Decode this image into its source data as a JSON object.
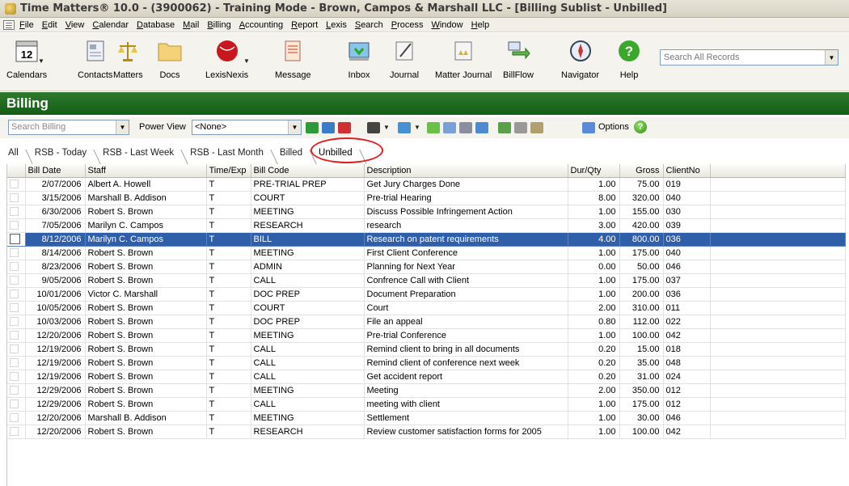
{
  "window": {
    "title": "Time Matters® 10.0 - (3900062) - Training Mode - Brown, Campos & Marshall LLC - [Billing Sublist - Unbilled]"
  },
  "menu": [
    "File",
    "Edit",
    "View",
    "Calendar",
    "Database",
    "Mail",
    "Billing",
    "Accounting",
    "Report",
    "Lexis",
    "Search",
    "Process",
    "Window",
    "Help"
  ],
  "toolbar": {
    "calendar_day": "12",
    "buttons": [
      {
        "label": "Calendars",
        "icon": "calendar-icon"
      },
      {
        "label": "Contacts",
        "icon": "contacts-icon"
      },
      {
        "label": "Matters",
        "icon": "scales-icon"
      },
      {
        "label": "Docs",
        "icon": "folder-icon"
      },
      {
        "label": "LexisNexis",
        "icon": "lexisnexis-icon"
      },
      {
        "label": "Message",
        "icon": "message-icon"
      },
      {
        "label": "Inbox",
        "icon": "inbox-icon"
      },
      {
        "label": "Journal",
        "icon": "journal-icon"
      },
      {
        "label": "Matter Journal",
        "icon": "matter-journal-icon"
      },
      {
        "label": "BillFlow",
        "icon": "billflow-icon"
      },
      {
        "label": "Navigator",
        "icon": "compass-icon"
      },
      {
        "label": "Help",
        "icon": "help-icon"
      }
    ],
    "search_placeholder": "Search All Records"
  },
  "billing": {
    "header": "Billing",
    "search_placeholder": "Search Billing",
    "power_view_label": "Power View",
    "power_view_value": "<None>",
    "options_label": "Options",
    "help_glyph": "?"
  },
  "tabs": [
    "All",
    "RSB - Today",
    "RSB - Last Week",
    "RSB - Last Month",
    "Billed",
    "Unbilled"
  ],
  "active_tab": "Unbilled",
  "table": {
    "columns": [
      "",
      "Bill Date",
      "Staff",
      "Time/Exp",
      "Bill Code",
      "Description",
      "Dur/Qty",
      "Gross",
      "ClientNo"
    ],
    "selected_row": 4,
    "rows": [
      [
        "2/07/2006",
        "Albert A. Howell",
        "T",
        "PRE-TRIAL PREP",
        "Get Jury Charges Done",
        "1.00",
        "75.00",
        "019"
      ],
      [
        "3/15/2006",
        "Marshall B. Addison",
        "T",
        "COURT",
        "Pre-trial Hearing",
        "8.00",
        "320.00",
        "040"
      ],
      [
        "6/30/2006",
        "Robert S. Brown",
        "T",
        "MEETING",
        "Discuss Possible Infringement Action",
        "1.00",
        "155.00",
        "030"
      ],
      [
        "7/05/2006",
        "Marilyn C. Campos",
        "T",
        "RESEARCH",
        "research",
        "3.00",
        "420.00",
        "039"
      ],
      [
        "8/12/2006",
        "Marilyn C. Campos",
        "T",
        "BILL",
        "Research on patent requirements",
        "4.00",
        "800.00",
        "036"
      ],
      [
        "8/14/2006",
        "Robert S. Brown",
        "T",
        "MEETING",
        "First Client Conference",
        "1.00",
        "175.00",
        "040"
      ],
      [
        "8/23/2006",
        "Robert S. Brown",
        "T",
        "ADMIN",
        "Planning for Next Year",
        "0.00",
        "50.00",
        "046"
      ],
      [
        "9/05/2006",
        "Robert S. Brown",
        "T",
        "CALL",
        "Confrence Call with Client",
        "1.00",
        "175.00",
        "037"
      ],
      [
        "10/01/2006",
        "Victor C. Marshall",
        "T",
        "DOC PREP",
        "Document Preparation",
        "1.00",
        "200.00",
        "036"
      ],
      [
        "10/05/2006",
        "Robert S. Brown",
        "T",
        "COURT",
        "Court",
        "2.00",
        "310.00",
        "011"
      ],
      [
        "10/03/2006",
        "Robert S. Brown",
        "T",
        "DOC PREP",
        "File an appeal",
        "0.80",
        "112.00",
        "022"
      ],
      [
        "12/20/2006",
        "Robert S. Brown",
        "T",
        "MEETING",
        "Pre-trial Conference",
        "1.00",
        "100.00",
        "042"
      ],
      [
        "12/19/2006",
        "Robert S. Brown",
        "T",
        "CALL",
        "Remind client to bring in all documents",
        "0.20",
        "15.00",
        "018"
      ],
      [
        "12/19/2006",
        "Robert S. Brown",
        "T",
        "CALL",
        "Remind client of conference next week",
        "0.20",
        "35.00",
        "048"
      ],
      [
        "12/19/2006",
        "Robert S. Brown",
        "T",
        "CALL",
        "Get accident report",
        "0.20",
        "31.00",
        "024"
      ],
      [
        "12/29/2006",
        "Robert S. Brown",
        "T",
        "MEETING",
        "Meeting",
        "2.00",
        "350.00",
        "012"
      ],
      [
        "12/29/2006",
        "Robert S. Brown",
        "T",
        "CALL",
        "meeting with client",
        "1.00",
        "175.00",
        "012"
      ],
      [
        "12/20/2006",
        "Marshall B. Addison",
        "T",
        "MEETING",
        "Settlement",
        "1.00",
        "30.00",
        "046"
      ],
      [
        "12/20/2006",
        "Robert S. Brown",
        "T",
        "RESEARCH",
        "Review customer satisfaction forms for 2005",
        "1.00",
        "100.00",
        "042"
      ]
    ]
  }
}
